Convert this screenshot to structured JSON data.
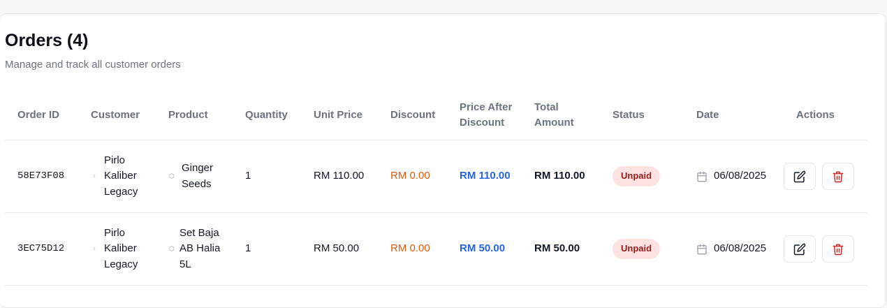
{
  "header": {
    "title": "Orders (4)",
    "subtitle": "Manage and track all customer orders"
  },
  "table": {
    "columns": [
      "Order ID",
      "Customer",
      "Product",
      "Quantity",
      "Unit Price",
      "Discount",
      "Price After Discount",
      "Total Amount",
      "Status",
      "Date",
      "Actions"
    ],
    "rows": [
      {
        "order_id": "58E73F08",
        "customer": "Pirlo Kaliber Legacy",
        "product": "Ginger Seeds",
        "quantity": "1",
        "unit_price": "RM 110.00",
        "discount": "RM 0.00",
        "price_after_discount": "RM 110.00",
        "total_amount": "RM 110.00",
        "status": "Unpaid",
        "date": "06/08/2025"
      },
      {
        "order_id": "3EC75D12",
        "customer": "Pirlo Kaliber Legacy",
        "product": "Set Baja AB Halia 5L",
        "quantity": "1",
        "unit_price": "RM 50.00",
        "discount": "RM 0.00",
        "price_after_discount": "RM 50.00",
        "total_amount": "RM 50.00",
        "status": "Unpaid",
        "date": "06/08/2025"
      }
    ]
  },
  "icons": {
    "customer": "user-icon",
    "product": "package-icon",
    "date": "calendar-icon",
    "edit": "edit-icon",
    "delete": "trash-icon"
  },
  "colors": {
    "discount": "#ea580c",
    "price_after_discount": "#2563eb",
    "status_unpaid_bg": "#fee2e2",
    "status_unpaid_text": "#991b1b",
    "delete": "#dc2626"
  }
}
